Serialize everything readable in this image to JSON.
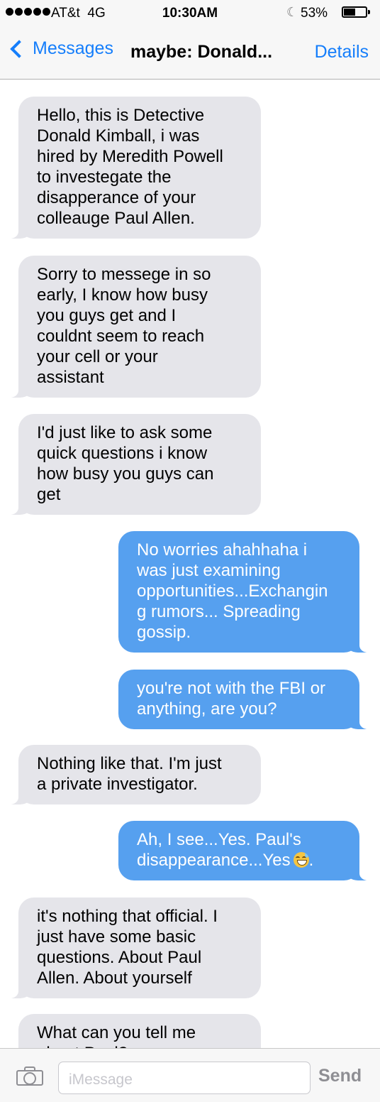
{
  "status_bar": {
    "carrier": "AT&t",
    "network": "4G",
    "time": "10:30AM",
    "battery_percent": "53%",
    "battery_level": 0.53
  },
  "nav": {
    "back_label": "Messages",
    "title": "maybe: Donald...",
    "details_label": "Details"
  },
  "messages": [
    {
      "dir": "in",
      "text": "Hello, this is Detective\nDonald Kimball, i was\nhired by Meredith Powell\nto investegate the\ndisapperance of your\ncolleauge Paul Allen."
    },
    {
      "dir": "in",
      "text": "Sorry to messege in so\nearly, I know how busy\nyou guys get and I\ncouldnt seem to reach\nyour cell or your\nassistant"
    },
    {
      "dir": "in",
      "text": "I'd just like to ask some\nquick questions i know\nhow busy you guys can\nget"
    },
    {
      "dir": "out",
      "text": "No worries ahahhaha i\nwas just examining\nopportunities...Exchangin\ng rumors... Spreading\ngossip."
    },
    {
      "dir": "out",
      "text": "you're not with the FBI or\nanything, are you?"
    },
    {
      "dir": "in",
      "text": "Nothing like that. I'm just\na private investigator."
    },
    {
      "dir": "out",
      "text": "Ah, I see...Yes. Paul's\ndisappearance...Yes",
      "emoji": "grinning-sweat-emoji",
      "suffix": "."
    },
    {
      "dir": "in",
      "text": "it's nothing that official. I\njust have some basic\nquestions. About Paul\nAllen. About yourself"
    },
    {
      "dir": "in",
      "text": "What can you tell me\nabout Paul?"
    }
  ],
  "input": {
    "placeholder": "iMessage",
    "send_label": "Send"
  },
  "colors": {
    "accent": "#157efb",
    "incoming_bubble": "#e5e5ea",
    "outgoing_bubble": "#56a0ef"
  }
}
